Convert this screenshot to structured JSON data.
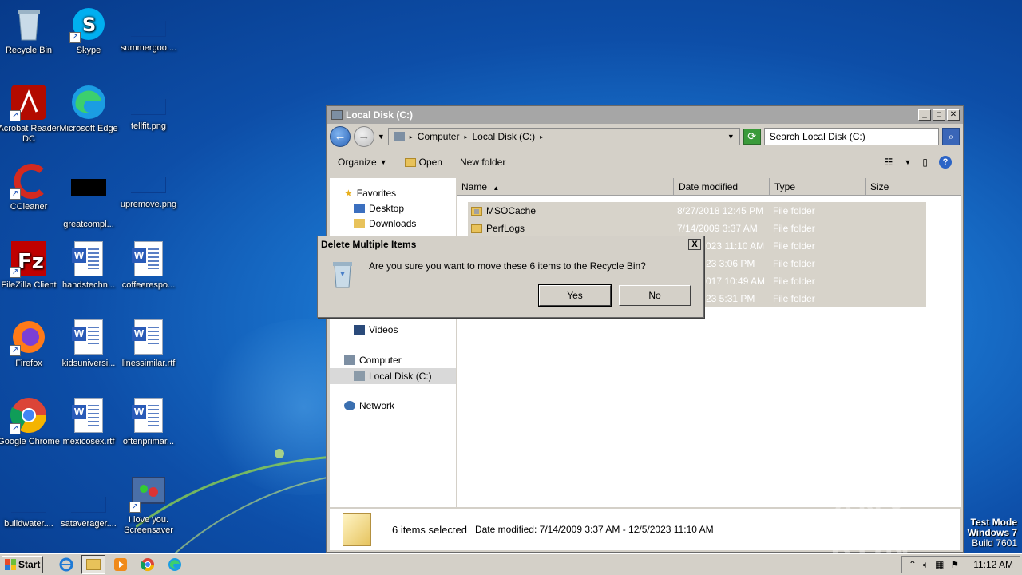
{
  "desktop": {
    "icons": [
      {
        "label": "Recycle Bin",
        "icon": "recycle-bin-icon"
      },
      {
        "label": "Skype",
        "icon": "skype-icon"
      },
      {
        "label": "summergoo....",
        "icon": "blank-image-icon"
      },
      {
        "label": "Acrobat Reader DC",
        "icon": "acrobat-icon"
      },
      {
        "label": "Microsoft Edge",
        "icon": "edge-icon"
      },
      {
        "label": "tellfit.png",
        "icon": "blank-image-icon"
      },
      {
        "label": "CCleaner",
        "icon": "ccleaner-icon"
      },
      {
        "label": "greatcompl...",
        "icon": "black-thumbnail-icon"
      },
      {
        "label": "upremove.png",
        "icon": "blank-image-icon"
      },
      {
        "label": "FileZilla Client",
        "icon": "filezilla-icon"
      },
      {
        "label": "handstechn...",
        "icon": "word-doc-icon"
      },
      {
        "label": "coffeerespo...",
        "icon": "word-doc-icon"
      },
      {
        "label": "Firefox",
        "icon": "firefox-icon"
      },
      {
        "label": "kidsuniversi...",
        "icon": "word-doc-icon"
      },
      {
        "label": "linessimilar.rtf",
        "icon": "word-doc-icon"
      },
      {
        "label": "Google Chrome",
        "icon": "chrome-icon"
      },
      {
        "label": "mexicosex.rtf",
        "icon": "word-doc-icon"
      },
      {
        "label": "oftenprimar...",
        "icon": "word-doc-icon"
      },
      {
        "label": "buildwater....",
        "icon": "blank-image-icon"
      },
      {
        "label": "sataverager....",
        "icon": "blank-image-icon"
      },
      {
        "label": "I love you. Screensaver",
        "icon": "screensaver-icon"
      }
    ]
  },
  "explorer": {
    "title": "Local Disk (C:)",
    "breadcrumb": [
      "Computer",
      "Local Disk (C:)"
    ],
    "search_placeholder": "Search Local Disk (C:)",
    "toolbar": {
      "organize": "Organize",
      "open": "Open",
      "new_folder": "New folder"
    },
    "nav": {
      "favorites": "Favorites",
      "desktop": "Desktop",
      "downloads": "Downloads",
      "videos": "Videos",
      "computer": "Computer",
      "local_disk": "Local Disk (C:)",
      "network": "Network"
    },
    "columns": {
      "name": "Name",
      "date": "Date modified",
      "type": "Type",
      "size": "Size"
    },
    "rows": [
      {
        "name": "MSOCache",
        "date": "8/27/2018 12:45 PM",
        "type": "File folder"
      },
      {
        "name": "PerfLogs",
        "date": "7/14/2009 3:37 AM",
        "type": "File folder"
      },
      {
        "name": "",
        "date": "023 11:10 AM",
        "type": "File folder"
      },
      {
        "name": "",
        "date": "23 3:06 PM",
        "type": "File folder"
      },
      {
        "name": "",
        "date": "017 10:49 AM",
        "type": "File folder"
      },
      {
        "name": "",
        "date": "23 5:31 PM",
        "type": "File folder"
      }
    ],
    "details": {
      "count": "6 items selected",
      "date_range": "Date modified: 7/14/2009 3:37 AM - 12/5/2023 11:10 AM"
    }
  },
  "dialog": {
    "title": "Delete Multiple Items",
    "message": "Are you sure you want to move these 6 items to the Recycle Bin?",
    "yes": "Yes",
    "no": "No",
    "close": "X"
  },
  "taskbar": {
    "start": "Start",
    "clock": "11:12 AM"
  },
  "watermark": "ANY RUN",
  "os_label": {
    "line1": "Test Mode",
    "line2": "Windows 7",
    "line3": "Build 7601"
  }
}
